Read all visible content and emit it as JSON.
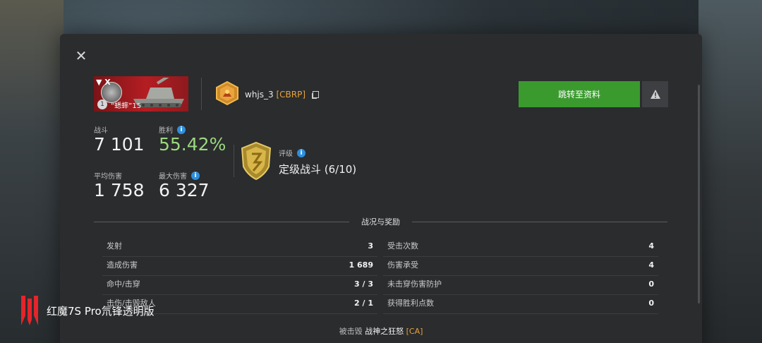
{
  "colors": {
    "accent_green": "#3a9a2e",
    "clan_orange": "#e7a33b",
    "winrate_green": "#9bd87e",
    "info_blue": "#2f8fdc"
  },
  "dialog": {
    "close_icon": "close-icon"
  },
  "tank": {
    "tier": "▼ X",
    "mastery": "1",
    "name": "“蟋蟀”15"
  },
  "player": {
    "name": "whjs_3",
    "clan": "[CBRP]"
  },
  "actions": {
    "profile_label": "跳转至资料",
    "report_icon": "warning-icon"
  },
  "stats": {
    "battles": {
      "label": "战斗",
      "value": "7 101"
    },
    "winrate": {
      "label": "胜利",
      "value": "55.42%"
    },
    "avg_damage": {
      "label": "平均伤害",
      "value": "1 758"
    },
    "max_damage": {
      "label": "最大伤害",
      "value": "6 327"
    }
  },
  "rating": {
    "label": "评级",
    "value": "定级战斗 (6/10)"
  },
  "battle_section": {
    "title": "战况与奖励"
  },
  "left_table": [
    {
      "key": "发射",
      "value": "3"
    },
    {
      "key": "造成伤害",
      "value": "1 689"
    },
    {
      "key": "命中/击穿",
      "value": "3 / 3"
    },
    {
      "key": "击伤/击毁敌人",
      "value": "2 / 1"
    }
  ],
  "right_table": [
    {
      "key": "受击次数",
      "value": "4"
    },
    {
      "key": "伤害承受",
      "value": "4"
    },
    {
      "key": "未击穿伤害防护",
      "value": "0"
    },
    {
      "key": "获得胜利点数",
      "value": "0"
    }
  ],
  "killed_by": {
    "prefix": "被击毁",
    "tank": "战神之狂怒",
    "clan": "[CA]"
  },
  "watermark": {
    "text": "红魔7S Pro氘锋透明版"
  }
}
